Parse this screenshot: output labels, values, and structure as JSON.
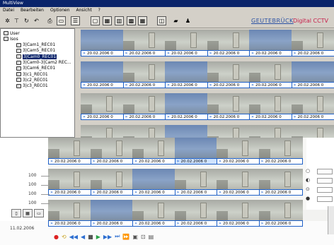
{
  "window": {
    "title": "MultiView"
  },
  "menu": [
    "Datei",
    "Bearbeiten",
    "Optionen",
    "Ansicht",
    "?"
  ],
  "brand": {
    "name": "GEUTEBRÜCK",
    "product": "Digital CCTV",
    "name_color": "#2950a3",
    "product_color": "#c81e4a"
  },
  "toolbar": {
    "icons": [
      "tools-icon",
      "pin-icon",
      "refresh-icon",
      "undo-icon",
      "print-icon",
      "layout-1-icon",
      "layout-list-icon",
      "monitor-icon",
      "layout-4-icon",
      "layout-9-icon",
      "layout-16-icon",
      "layout-25-icon",
      "split-icon",
      "folder-icon",
      "user-icon"
    ],
    "glyphs": [
      "✲",
      "⊤",
      "↻",
      "↶",
      "⎙",
      "▭",
      "☰",
      "▢",
      "▦",
      "▥",
      "▩",
      "▦",
      "◫",
      "▰",
      "♟"
    ]
  },
  "tree": {
    "items": [
      {
        "label": "User",
        "level": 0
      },
      {
        "label": "Isos",
        "level": 0
      },
      {
        "label": "3|Cam1_REC01",
        "level": 2
      },
      {
        "label": "3|Cam5_REC01",
        "level": 2
      },
      {
        "label": "3|Cam0_REC01",
        "level": 2,
        "selected": true
      },
      {
        "label": "3|Cam0-3|Cam2 REC...",
        "level": 2
      },
      {
        "label": "3|Cam6_REC01",
        "level": 2
      },
      {
        "label": "3|c1_REC01",
        "level": 2
      },
      {
        "label": "3|c2_REC01",
        "level": 2
      },
      {
        "label": "3|c3_REC01",
        "level": 2
      }
    ]
  },
  "upper_grid": {
    "cells": [
      {
        "label": "20.02.2006 0",
        "blue": true
      },
      {
        "label": "20.02.2006 0"
      },
      {
        "label": "20.02.2006 0"
      },
      {
        "label": "20.02.2006 0"
      },
      {
        "label": "20.02.2006 0",
        "blue": true
      },
      {
        "label": "20.02.2006 0"
      },
      {
        "label": "20.02.2006 0",
        "blue": true
      },
      {
        "label": "20.02.2006 0"
      },
      {
        "label": "20.02.2006 0",
        "blue": true
      },
      {
        "label": "20.02.2006 0"
      },
      {
        "label": "20.02.2006 0"
      },
      {
        "label": "20.02.2006 0",
        "blue": true
      },
      {
        "label": "20.02.2006 0"
      },
      {
        "label": "20.02.2006 0"
      },
      {
        "label": "20.02.2006 0",
        "blue": true
      },
      {
        "label": "20.02.2006 0"
      },
      {
        "label": "20.02.2006 0"
      },
      {
        "label": "20.02.2006 0"
      },
      {
        "label": "20.02.2006 0"
      },
      {
        "label": "20.02.2006 0"
      },
      {
        "label": "20.02.2006 0",
        "blue": true
      },
      {
        "label": "20.02.2006 0"
      },
      {
        "label": "20.02.2006 0"
      },
      {
        "label": "20.02.2006 0"
      }
    ]
  },
  "lower_grid": {
    "cells": [
      {
        "label": "20.02.2006 0"
      },
      {
        "label": "20.02.2006 0"
      },
      {
        "label": "20.02.2006 0"
      },
      {
        "label": "20.02.2006 0",
        "blue": true,
        "selected": true
      },
      {
        "label": "20.02.2006 0"
      },
      {
        "label": "20.02.2006 0"
      },
      {
        "label": "20.02.2006 0"
      },
      {
        "label": "20.02.2006 0"
      },
      {
        "label": "20.02.2006 0",
        "blue": true
      },
      {
        "label": "20.02.2006 0"
      },
      {
        "label": "20.02.2006 0"
      },
      {
        "label": "20.02.2006 0"
      },
      {
        "label": "20.02.2006 0"
      },
      {
        "label": "20.02.2006 0",
        "blue": true
      },
      {
        "label": "20.02.2006 0"
      },
      {
        "label": "20.02.2006 0"
      },
      {
        "label": "20.02.2006 0"
      },
      {
        "label": "20.02.2006 0"
      }
    ]
  },
  "side_labels": [
    "100",
    "100",
    "100",
    "100"
  ],
  "right_controls": [
    "○",
    "◐",
    "⊙",
    "●"
  ],
  "timestamp": "11.02.2006",
  "bottom_controls": [
    "●",
    "⟲",
    "◀◀",
    "◀",
    "■",
    "▶",
    "▶▶",
    "⏭",
    "⏩",
    "▣",
    "⊡",
    "▤"
  ]
}
